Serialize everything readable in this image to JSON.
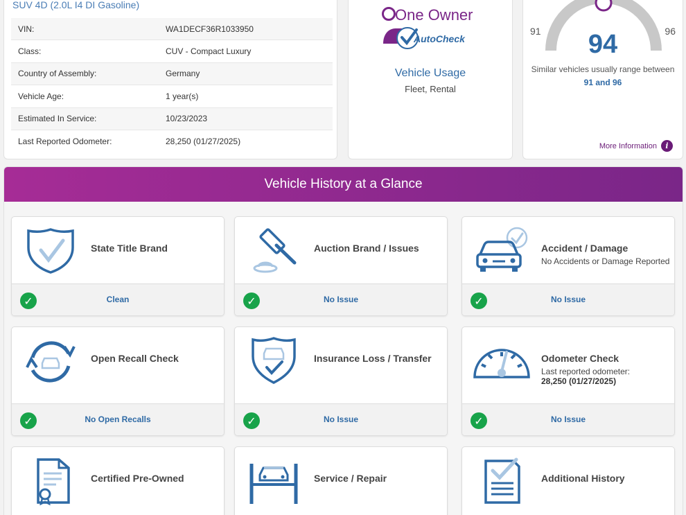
{
  "specs": {
    "title": "SUV 4D (2.0L I4 DI Gasoline)",
    "rows": [
      {
        "label": "VIN:",
        "value": "WA1DECF36R1033950"
      },
      {
        "label": "Class:",
        "value": "CUV - Compact Luxury"
      },
      {
        "label": "Country of Assembly:",
        "value": "Germany"
      },
      {
        "label": "Vehicle Age:",
        "value": "1 year(s)"
      },
      {
        "label": "Estimated In Service:",
        "value": "10/23/2023"
      },
      {
        "label": "Last Reported Odometer:",
        "value": "28,250 (01/27/2025)"
      }
    ]
  },
  "owner": {
    "logo_line1": "One Owner",
    "logo_line2": "AutoCheck",
    "usage_title": "Vehicle Usage",
    "usage_value": "Fleet, Rental"
  },
  "score": {
    "value": "94",
    "range_min": "91",
    "range_max": "96",
    "desc_prefix": "Similar vehicles usually range between ",
    "desc_range": "91 and 96",
    "more_info": "More Information",
    "info_glyph": "i"
  },
  "glance": {
    "title": "Vehicle History at a Glance",
    "check_glyph": "✓",
    "tiles": [
      {
        "icon": "shield-check-icon",
        "title": "State Title Brand",
        "subtitle": "",
        "status": "Clean"
      },
      {
        "icon": "auction-gavel-icon",
        "title": "Auction Brand / Issues",
        "subtitle": "",
        "status": "No Issue"
      },
      {
        "icon": "car-damage-icon",
        "title": "Accident / Damage",
        "subtitle": "No Accidents or Damage Reported",
        "status": "No Issue"
      },
      {
        "icon": "recall-cycle-icon",
        "title": "Open Recall Check",
        "subtitle": "",
        "status": "No Open Recalls"
      },
      {
        "icon": "insurance-shield-icon",
        "title": "Insurance Loss / Transfer",
        "subtitle": "",
        "status": "No Issue"
      },
      {
        "icon": "odometer-gauge-icon",
        "title": "Odometer Check",
        "subtitle": "Last reported odometer:",
        "subtitle_bold": "28,250 (01/27/2025)",
        "status": "No Issue"
      },
      {
        "icon": "certificate-icon",
        "title": "Certified Pre-Owned",
        "subtitle": "",
        "status": ""
      },
      {
        "icon": "car-lift-icon",
        "title": "Service / Repair",
        "subtitle": "",
        "status": ""
      },
      {
        "icon": "clipboard-check-icon",
        "title": "Additional History",
        "subtitle": "",
        "status": ""
      }
    ]
  },
  "colors": {
    "accent_blue": "#2f6aa5",
    "purple": "#7a2688",
    "green": "#18a34a"
  }
}
